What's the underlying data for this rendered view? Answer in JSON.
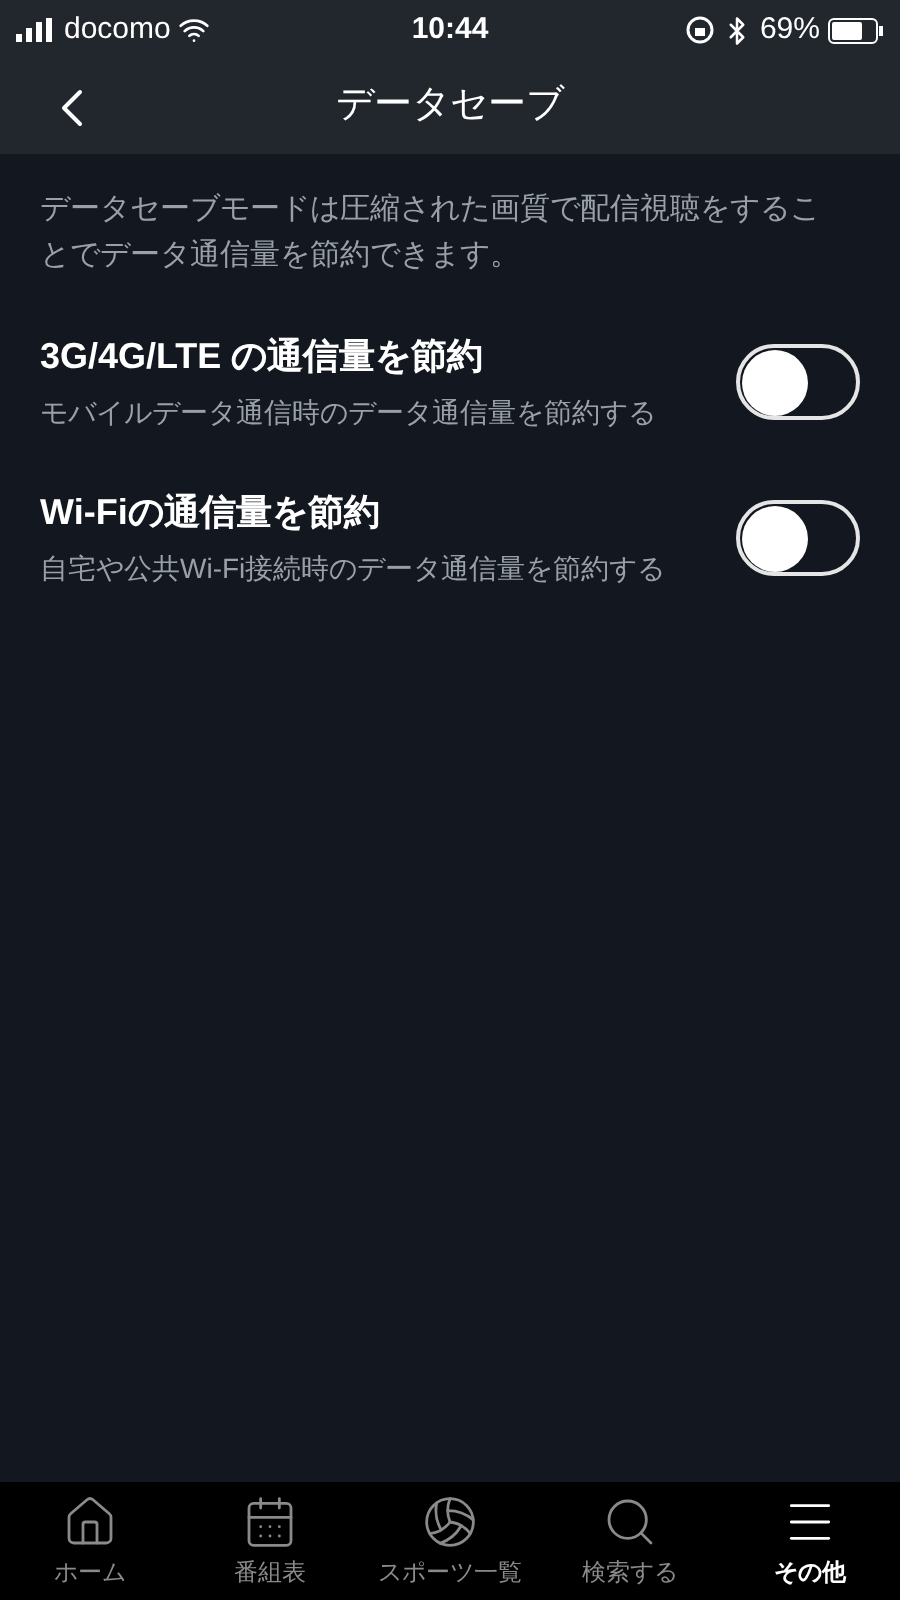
{
  "status_bar": {
    "carrier": "docomo",
    "time": "10:44",
    "battery": "69%"
  },
  "header": {
    "title": "データセーブ"
  },
  "description": "データセーブモードは圧縮された画質で配信視聴をすることでデータ通信量を節約できます。",
  "settings": [
    {
      "title": "3G/4G/LTE の通信量を節約",
      "subtitle": "モバイルデータ通信時のデータ通信量を節約する",
      "on": false
    },
    {
      "title": "Wi-Fiの通信量を節約",
      "subtitle": "自宅や公共Wi-Fi接続時のデータ通信量を節約する",
      "on": false
    }
  ],
  "tab_bar": [
    {
      "kind": "home",
      "label": "ホーム",
      "selected": false
    },
    {
      "kind": "schedule",
      "label": "番組表",
      "selected": false
    },
    {
      "kind": "sports",
      "label": "スポーツ一覧",
      "selected": false
    },
    {
      "kind": "search",
      "label": "検索する",
      "selected": false
    },
    {
      "kind": "more",
      "label": "その他",
      "selected": true
    }
  ]
}
